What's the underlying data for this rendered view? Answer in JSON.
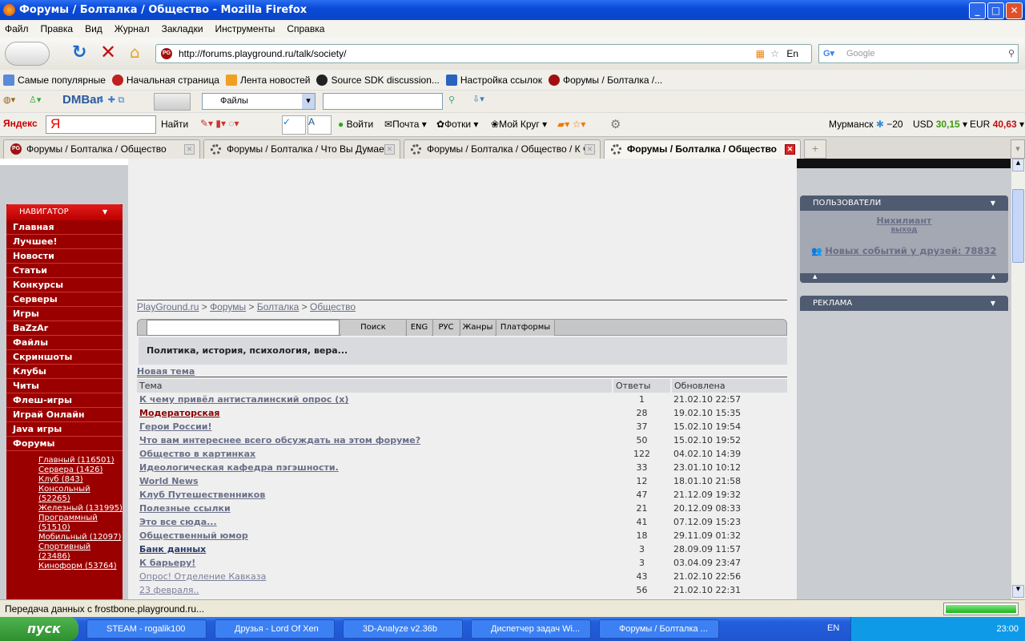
{
  "window": {
    "title": "Форумы / Болталка / Общество - Mozilla Firefox"
  },
  "menu": [
    "Файл",
    "Правка",
    "Вид",
    "Журнал",
    "Закладки",
    "Инструменты",
    "Справка"
  ],
  "nav": {
    "url": "http://forums.playground.ru/talk/society/",
    "search_placeholder": "Google",
    "lang": "En"
  },
  "bookmarks": [
    "Самые популярные",
    "Начальная страница",
    "Лента новостей",
    "Source SDK discussion...",
    "Настройка ссылок",
    "Форумы / Болталка /..."
  ],
  "dmbar": {
    "logo": "DMBar",
    "select": "Файлы"
  },
  "yandex": {
    "logo": "Яндекс",
    "find": "Найти",
    "login": "Войти",
    "mail": "Почта",
    "photos": "Фотки",
    "circle": "Мой Круг",
    "city": "Мурманск",
    "temp": "−20",
    "usd_label": "USD",
    "usd": "30,15",
    "eur_label": "EUR",
    "eur": "40,63",
    "usd_color": "#3a9a10",
    "eur_color": "#c01010"
  },
  "tabs": [
    {
      "title": "Форумы / Болталка / Общество"
    },
    {
      "title": "Форумы / Болталка / Что Вы Думает..."
    },
    {
      "title": "Форумы / Болталка / Общество / К ч..."
    },
    {
      "title": "Форумы / Болталка / Общество",
      "active": true
    }
  ],
  "sidebar": {
    "header": "НАВИГАТОР",
    "items": [
      "Главная",
      "Лучшее!",
      "Новости",
      "Статьи",
      "Конкурсы",
      "Серверы",
      "Игры",
      "BaZzAr",
      "Файлы",
      "Скриншоты",
      "Клубы",
      "Читы",
      "Флеш-игры",
      "Играй Онлайн",
      "Java игры",
      "Форумы"
    ],
    "forums": [
      "Главный (116501)",
      "Сервера (1426)",
      "Клуб (843)",
      "Консольный (52265)",
      "Железный (131995)",
      "Программный (51510)",
      "Мобильный (12097)",
      "Спортивный (23486)",
      "Киноформ (53764)"
    ]
  },
  "breadcrumb": [
    "PlayGround.ru",
    "Форумы",
    "Болталка",
    "Общество"
  ],
  "searchbar": {
    "search": "Поиск",
    "eng": "ENG",
    "rus": "РУС",
    "genres": "Жанры",
    "platforms": "Платформы"
  },
  "description": "Политика, история, психология, вера...",
  "new_topic": "Новая тема",
  "table": {
    "headers": [
      "Тема",
      "Ответы",
      "Обновлена"
    ],
    "rows": [
      {
        "t": "К чему привёл антисталинский опрос (x)",
        "n": "1",
        "d": "21.02.10 22:57",
        "s": "b"
      },
      {
        "t": "Модераторская",
        "n": "28",
        "d": "19.02.10 15:35",
        "s": "r"
      },
      {
        "t": "Герои России!",
        "n": "37",
        "d": "15.02.10 19:54",
        "s": "b"
      },
      {
        "t": "Что вам интереснее всего обсуждать на этом форуме?",
        "n": "50",
        "d": "15.02.10 19:52",
        "s": "b"
      },
      {
        "t": "Общество в картинках",
        "n": "122",
        "d": "04.02.10 14:39",
        "s": "b"
      },
      {
        "t": "Идеологическая кафедра пэгэшности.",
        "n": "33",
        "d": "23.01.10 10:12",
        "s": "b"
      },
      {
        "t": "World News",
        "n": "12",
        "d": "18.01.10 21:58",
        "s": "b"
      },
      {
        "t": "Клуб Путешественников",
        "n": "47",
        "d": "21.12.09 19:32",
        "s": "b"
      },
      {
        "t": "Полезные ссылки",
        "n": "21",
        "d": "20.12.09 08:33",
        "s": "b"
      },
      {
        "t": "Это все сюда...",
        "n": "41",
        "d": "07.12.09 15:23",
        "s": "b"
      },
      {
        "t": "Общественный юмор",
        "n": "18",
        "d": "29.11.09 01:32",
        "s": "b"
      },
      {
        "t": "Банк данных",
        "n": "3",
        "d": "28.09.09 11:57",
        "s": "d"
      },
      {
        "t": "К барьеру!",
        "n": "3",
        "d": "03.04.09 23:47",
        "s": "b"
      },
      {
        "t": "Опрос! Отделение Кавказа",
        "n": "43",
        "d": "21.02.10 22:56",
        "s": "n"
      },
      {
        "t": "23 февраля..",
        "n": "56",
        "d": "21.02.10 22:31",
        "s": "n"
      }
    ]
  },
  "users": {
    "header": "ПОЛЬЗОВАТЕЛИ",
    "name": "Нихилиант",
    "logout": "выход",
    "events": "Новых событий у друзей: 78832"
  },
  "ads": {
    "header": "РЕКЛАМА"
  },
  "status": "Передача данных с frostbone.playground.ru...",
  "taskbar": {
    "start": "пуск",
    "items": [
      "STEAM - rogalik100",
      "Друзья - Lord Of Xen",
      "3D-Analyze v2.36b",
      "Диспетчер задач Wi...",
      "Форумы / Болталка ..."
    ],
    "lang": "EN",
    "clock": "23:00"
  }
}
